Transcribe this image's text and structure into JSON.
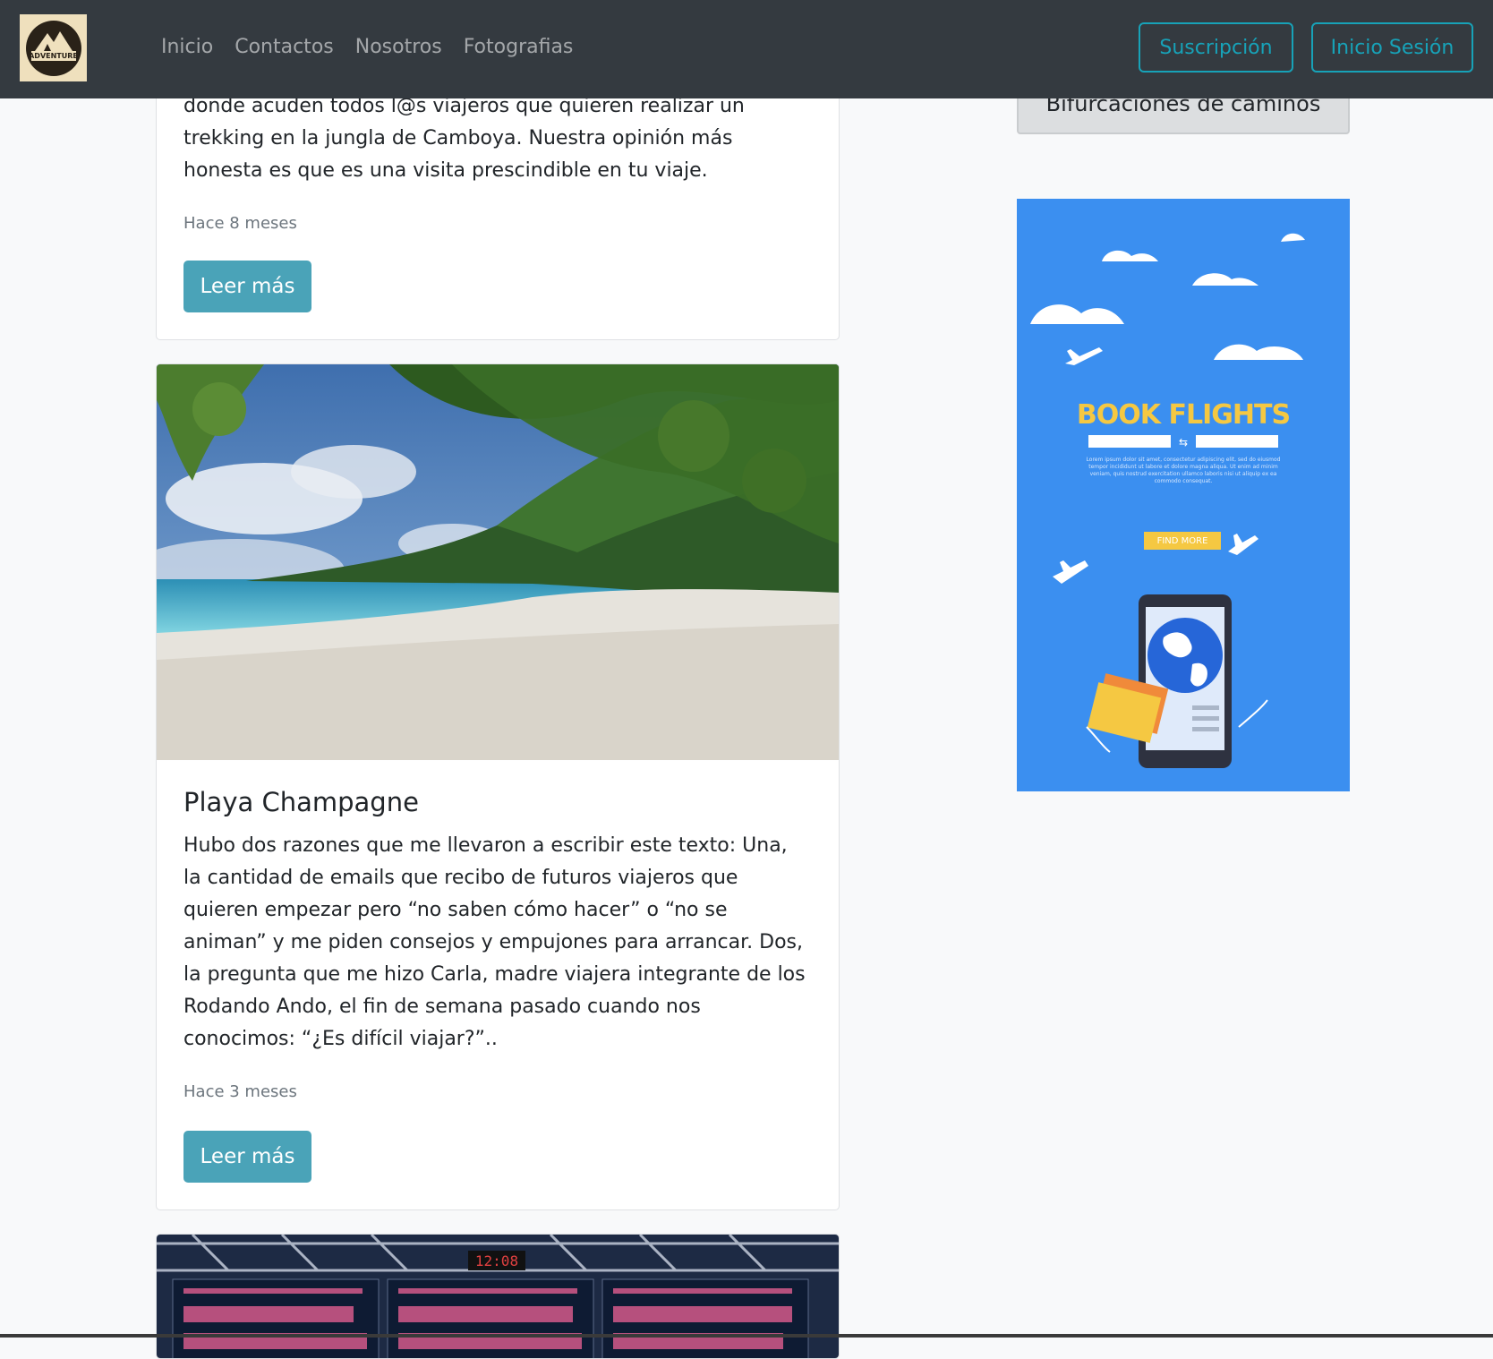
{
  "navbar": {
    "logo_text": "ADVENTURE",
    "links": [
      "Inicio",
      "Contactos",
      "Nosotros",
      "Fotografias"
    ],
    "subscribe_label": "Suscripción",
    "login_label": "Inicio Sesión"
  },
  "posts": [
    {
      "excerpt": "donde acuden todos l@s viajeros que quieren realizar un trekking en la jungla de Camboya. Nuestra opinión más honesta es que es una visita prescindible en tu viaje.",
      "time": "Hace 8 meses",
      "button": "Leer más"
    },
    {
      "title": "Playa Champagne",
      "excerpt": "Hubo dos razones que me llevaron a escribir este texto: Una, la cantidad de emails que recibo de futuros viajeros que quieren empezar pero “no saben cómo hacer” o “no se animan” y me piden consejos y empujones para arrancar. Dos, la pregunta que me hizo Carla, madre viajera integrante de los Rodando Ando, el fin de semana pasado cuando nos conocimos: “¿Es difícil viajar?”..",
      "time": "Hace 3 meses",
      "button": "Leer más"
    },
    {
      "board_clock": "12:08"
    }
  ],
  "sidebar": {
    "category_button": "Bifurcaciones de caminos",
    "ad": {
      "title": "BOOK FLIGHTS",
      "lorem": "Lorem ipsum dolor sit amet, consectetur adipiscing elit, sed do eiusmod tempor incididunt ut labore et dolore magna aliqua. Ut enim ad minim veniam, quis nostrud exercitation ullamco laboris nisi ut aliquip ex ea commodo consequat.",
      "cta": "FIND MORE"
    }
  },
  "colors": {
    "navbar_bg": "#343a40",
    "accent": "#17a2b8",
    "read_button": "#4aa3b8",
    "ad_bg": "#3b8ff0",
    "ad_title": "#f5c842"
  }
}
